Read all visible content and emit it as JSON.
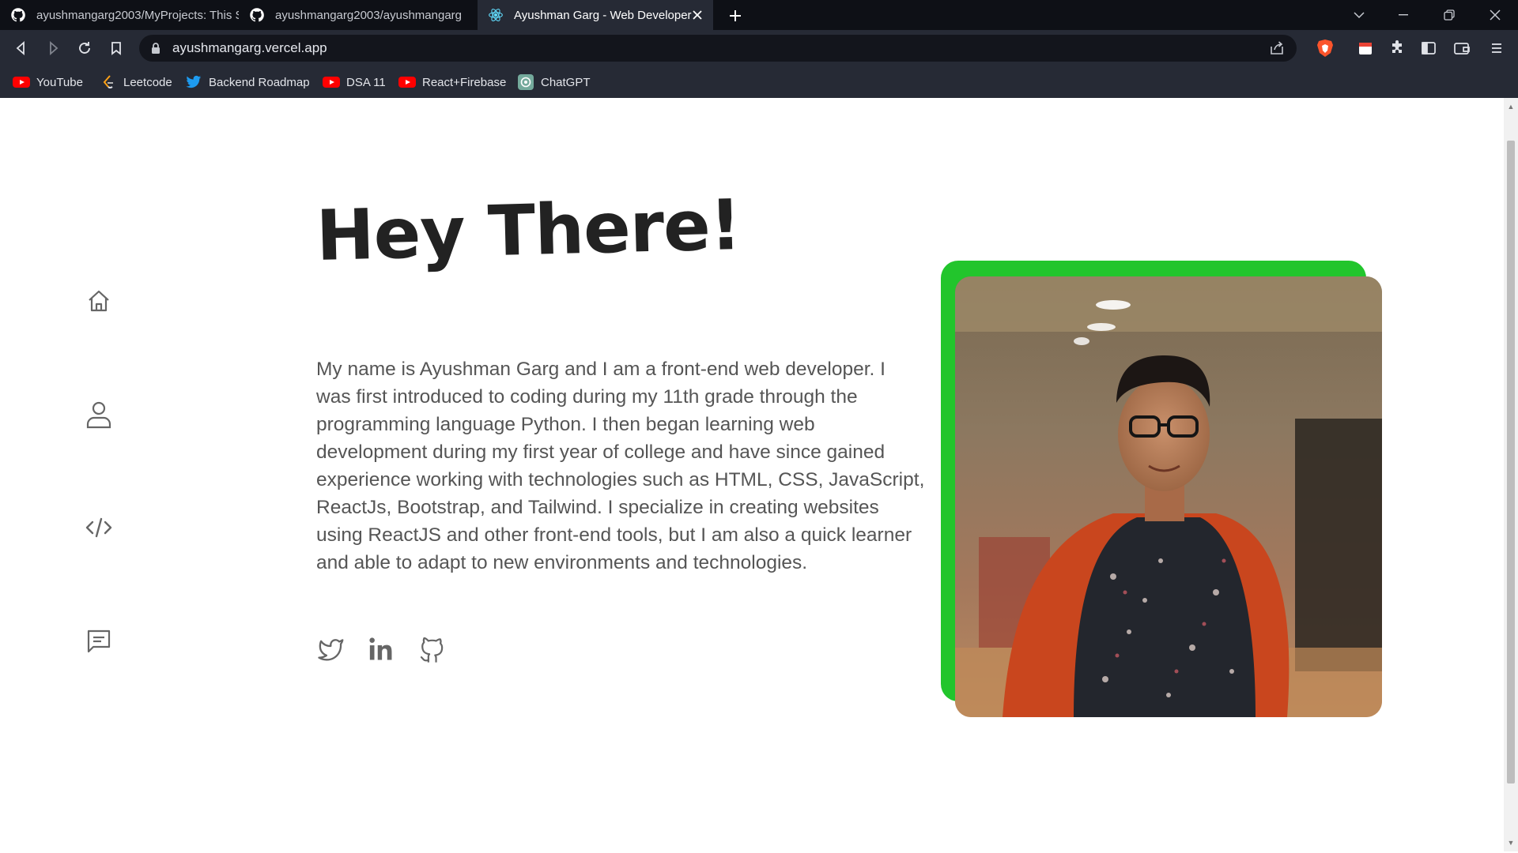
{
  "browser": {
    "tabs": [
      {
        "title": "ayushmangarg2003/MyProjects: This S",
        "icon": "github-icon",
        "active": false
      },
      {
        "title": "ayushmangarg2003/ayushmangarg",
        "icon": "github-icon",
        "active": false
      },
      {
        "title": "Ayushman Garg - Web Developer",
        "icon": "react-icon",
        "active": true
      }
    ],
    "url": "ayushmangarg.vercel.app",
    "bookmarks": [
      {
        "label": "YouTube",
        "icon": "youtube-icon"
      },
      {
        "label": "Leetcode",
        "icon": "leetcode-icon"
      },
      {
        "label": "Backend Roadmap",
        "icon": "twitter-icon"
      },
      {
        "label": "DSA 11",
        "icon": "youtube-icon"
      },
      {
        "label": "React+Firebase",
        "icon": "youtube-icon"
      },
      {
        "label": "ChatGPT",
        "icon": "chatgpt-icon"
      }
    ],
    "colors": {
      "tabbar": "#0e1016",
      "toolbar": "#262a35",
      "brave": "#fb542b"
    }
  },
  "page": {
    "title": "Hey There!",
    "bio": "My name is Ayushman Garg and I am a front-end web developer. I was first introduced to coding during my 11th grade through the programming language Python. I then began learning web development during my first year of college and have since gained experience working with technologies such as HTML, CSS, JavaScript, ReactJs, Bootstrap, and Tailwind. I specialize in creating websites using ReactJS and other front-end tools, but I am also a quick learner and able to adapt to new environments and technologies.",
    "sidenav": [
      "home-icon",
      "user-icon",
      "code-icon",
      "message-icon"
    ],
    "socials": [
      "twitter-icon",
      "linkedin-icon",
      "github-icon"
    ],
    "colors": {
      "accent": "#22c52c",
      "heading": "#222222",
      "text": "#555555",
      "icon": "#666666"
    }
  }
}
